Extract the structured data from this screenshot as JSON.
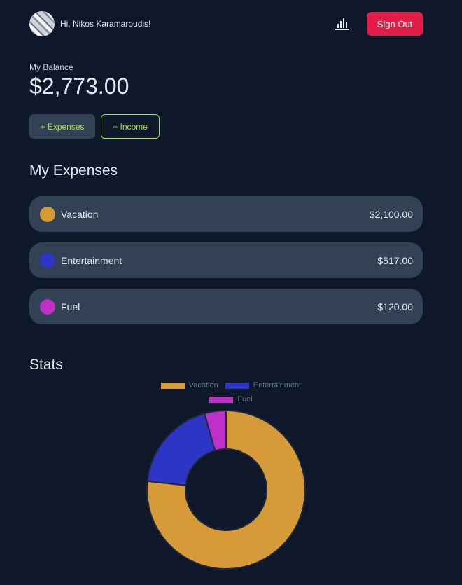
{
  "header": {
    "greeting": "Hi, Nikos Karamaroudis!",
    "signout_label": "Sign Out",
    "stats_icon": "bar-chart-icon"
  },
  "balance": {
    "label": "My Balance",
    "value": "$2,773.00"
  },
  "actions": {
    "expenses_label": "+ Expenses",
    "income_label": "+ Income"
  },
  "expenses_section": {
    "title": "My Expenses",
    "items": [
      {
        "name": "Vacation",
        "amount": "$2,100.00",
        "color": "#d69a38"
      },
      {
        "name": "Entertainment",
        "amount": "$517.00",
        "color": "#2d35c4"
      },
      {
        "name": "Fuel",
        "amount": "$120.00",
        "color": "#c030c8"
      }
    ]
  },
  "stats_section": {
    "title": "Stats"
  },
  "colors": {
    "background": "#0f172a",
    "card": "#334155",
    "accent": "#a3e635",
    "signout": "#e11d48"
  },
  "chart_data": {
    "type": "pie",
    "style": "doughnut",
    "categories": [
      "Vacation",
      "Entertainment",
      "Fuel"
    ],
    "values": [
      2100,
      517,
      120
    ],
    "colors": [
      "#d69a38",
      "#2d35c4",
      "#c030c8"
    ],
    "legend": "top"
  }
}
